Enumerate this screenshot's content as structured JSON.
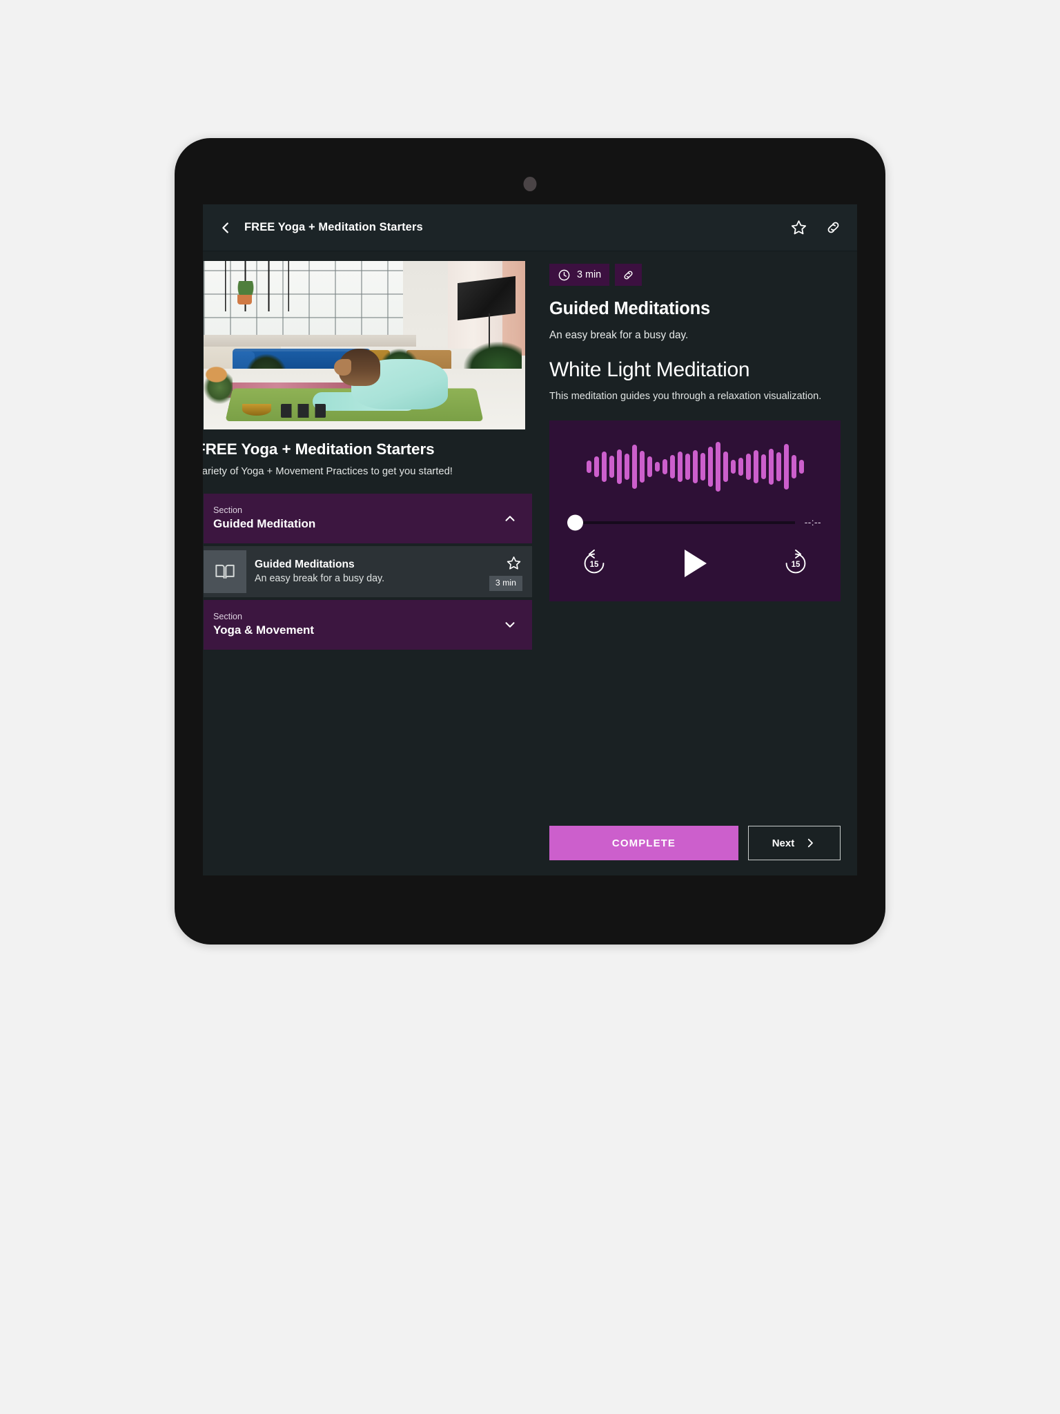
{
  "appbar": {
    "back_icon": "chevron-left-icon",
    "title": "FREE Yoga + Meditation Starters",
    "favorite_icon": "star-outline-icon",
    "share_icon": "link-icon"
  },
  "course": {
    "title": "FREE Yoga + Meditation Starters",
    "description": "Variety of Yoga + Movement Practices to get you started!",
    "hero_image_alt": "woman stretching on a green yoga mat in a sunlit studio"
  },
  "curriculum": {
    "sections": [
      {
        "kicker": "Section",
        "name": "Guided Meditation",
        "expanded": true,
        "chevron_icon": "chevron-up-icon",
        "lessons": [
          {
            "thumb_icon": "book-open-icon",
            "title": "Guided Meditations",
            "subtitle": "An easy break for a busy day.",
            "duration": "3 min",
            "favorite_icon": "star-outline-icon"
          }
        ]
      },
      {
        "kicker": "Section",
        "name": "Yoga & Movement",
        "expanded": false,
        "chevron_icon": "chevron-down-icon",
        "lessons": []
      }
    ]
  },
  "lesson": {
    "duration_badge": "3 min",
    "duration_icon": "clock-icon",
    "share_icon": "link-icon",
    "heading": "Guided Meditations",
    "subheading": "An easy break for a busy day.",
    "title": "White Light Meditation",
    "description": "This meditation guides you through a relaxation visualization."
  },
  "player": {
    "elapsed_label": "--:--",
    "progress_percent": 0,
    "rewind_label": "15",
    "forward_label": "15",
    "rewind_icon": "replay-15-icon",
    "play_icon": "play-icon",
    "forward_icon": "forward-15-icon",
    "waveform": [
      18,
      30,
      44,
      32,
      50,
      38,
      64,
      46,
      30,
      14,
      22,
      34,
      44,
      38,
      48,
      40,
      58,
      72,
      44,
      20,
      26,
      38,
      48,
      36,
      52,
      42,
      66,
      34,
      20
    ]
  },
  "footer": {
    "complete_label": "COMPLETE",
    "next_label": "Next",
    "next_icon": "chevron-right-icon"
  },
  "colors": {
    "page_background": "#f2f2f2",
    "device_frame": "#131313",
    "screen_background": "#1a2123",
    "appbar_background": "#1c2427",
    "section_purple": "#3c1640",
    "badge_purple": "#3c1040",
    "player_purple": "#2e1036",
    "accent_magenta": "#cc5fcc",
    "lesson_row": "#2c3236",
    "thumb_grey": "#4b5258"
  }
}
